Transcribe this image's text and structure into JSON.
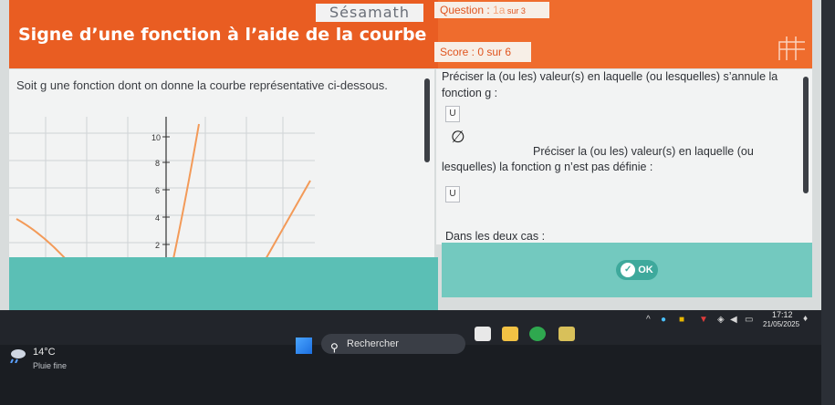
{
  "app": {
    "logo": "Sésamath",
    "page_title": "Signe d’une fonction à l’aide de la courbe"
  },
  "question_box": {
    "label": "Question : ",
    "number": "1a",
    "total": " sur 3"
  },
  "score": "Score : 0 sur 6",
  "left_panel": {
    "instruction": "Soit g une fonction dont on donne la courbe représentative ci-dessous.",
    "graph": {
      "y_ticks": [
        "10",
        "8",
        "6",
        "4",
        "2"
      ],
      "curve_color": "#f39a58",
      "grid_color": "#cfd3d6"
    }
  },
  "right_panel": {
    "q1_line1": "Préciser la (ou les) valeur(s) en laquelle (ou lesquelles) s’annule la",
    "q1_line2": "fonction g :",
    "input1_value": "U",
    "empty_set": "∅",
    "q2": "Préciser la (ou les) valeur(s) en laquelle (ou lesquelles) la fonction g n’est pas définie :",
    "input2_value": "U",
    "q3": "Dans les deux cas :"
  },
  "ok_button": "OK",
  "taskbar": {
    "weather_temp": "14°C",
    "weather_desc": "Pluie fine",
    "search_label": "Rechercher",
    "time": "17:12",
    "date": "21/05/2025"
  },
  "colors": {
    "header": "#ef6c2d",
    "teal": "#5bbfb5",
    "ok_green": "#3ea99c"
  }
}
